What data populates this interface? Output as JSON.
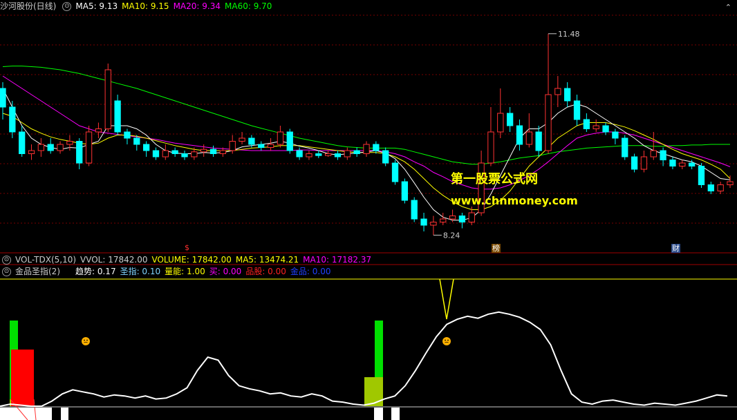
{
  "price_header": {
    "title": "沙河股份(日线)",
    "ma5": "MA5: 9.13",
    "ma10": "MA10: 9.15",
    "ma20": "MA20: 9.34",
    "ma60": "MA60: 9.70",
    "colors": {
      "ma5": "#ffffff",
      "ma10": "#ffff00",
      "ma20": "#ff00ff",
      "ma60": "#00ff00"
    }
  },
  "price_chart": {
    "high_label": "11.48",
    "low_label": "8.24",
    "markers": {
      "s": "$",
      "bang": "榜",
      "cai": "财"
    },
    "up_color": "#ff3232",
    "down_color": "#00ffff"
  },
  "volume_header": {
    "name": "VOL-TDX(5,10)",
    "vvol": "VVOL: 17842.00",
    "volume": "VOLUME: 17842.00",
    "ma5": "MA5: 13474.21",
    "ma10": "MA10: 17182.37"
  },
  "indicator_header": {
    "name": "金品圣指(2)",
    "trend": "趋势: 0.17",
    "sheng": "圣指: 0.10",
    "liang": "量能: 1.00",
    "buy": "买: 0.00",
    "pin": "品股: 0.00",
    "jinpin": "金品: 0.00"
  },
  "watermark": {
    "cn": "第一股票公式网",
    "url": "www.chnmoney.com"
  },
  "chart_data": {
    "type": "candlestick",
    "ylim": [
      8.0,
      11.8
    ],
    "high": 11.48,
    "low": 8.24,
    "candles": [
      [
        10.6,
        10.3,
        10.7,
        10.1
      ],
      [
        10.3,
        9.9,
        10.4,
        9.8
      ],
      [
        9.9,
        9.55,
        10.0,
        9.5
      ],
      [
        9.55,
        9.6,
        9.7,
        9.45
      ],
      [
        9.6,
        9.7,
        9.8,
        9.5
      ],
      [
        9.7,
        9.6,
        9.8,
        9.55
      ],
      [
        9.6,
        9.7,
        9.75,
        9.55
      ],
      [
        9.7,
        9.75,
        9.85,
        9.6
      ],
      [
        9.75,
        9.4,
        9.8,
        9.3
      ],
      [
        9.4,
        9.9,
        10.0,
        9.35
      ],
      [
        9.9,
        9.95,
        10.05,
        9.8
      ],
      [
        9.95,
        10.9,
        11.0,
        9.9
      ],
      [
        10.4,
        9.9,
        10.5,
        9.85
      ],
      [
        9.9,
        9.8,
        9.95,
        9.7
      ],
      [
        9.8,
        9.7,
        9.85,
        9.6
      ],
      [
        9.7,
        9.6,
        9.75,
        9.5
      ],
      [
        9.6,
        9.5,
        9.65,
        9.45
      ],
      [
        9.5,
        9.6,
        9.7,
        9.45
      ],
      [
        9.6,
        9.55,
        9.65,
        9.5
      ],
      [
        9.55,
        9.5,
        9.6,
        9.45
      ],
      [
        9.5,
        9.58,
        9.65,
        9.45
      ],
      [
        9.58,
        9.62,
        9.7,
        9.5
      ],
      [
        9.62,
        9.55,
        9.68,
        9.5
      ],
      [
        9.55,
        9.6,
        9.65,
        9.5
      ],
      [
        9.6,
        9.75,
        9.85,
        9.55
      ],
      [
        9.75,
        9.8,
        9.9,
        9.7
      ],
      [
        9.8,
        9.7,
        9.85,
        9.65
      ],
      [
        9.7,
        9.65,
        9.75,
        9.6
      ],
      [
        9.65,
        9.7,
        9.8,
        9.6
      ],
      [
        9.7,
        9.9,
        10.0,
        9.65
      ],
      [
        9.9,
        9.6,
        9.95,
        9.55
      ],
      [
        9.6,
        9.5,
        9.65,
        9.45
      ],
      [
        9.5,
        9.55,
        9.6,
        9.45
      ],
      [
        9.55,
        9.52,
        9.6,
        9.48
      ],
      [
        9.52,
        9.55,
        9.6,
        9.5
      ],
      [
        9.55,
        9.5,
        9.6,
        9.45
      ],
      [
        9.5,
        9.6,
        9.65,
        9.45
      ],
      [
        9.6,
        9.55,
        9.65,
        9.5
      ],
      [
        9.55,
        9.7,
        9.75,
        9.5
      ],
      [
        9.7,
        9.6,
        9.75,
        9.55
      ],
      [
        9.6,
        9.4,
        9.65,
        9.35
      ],
      [
        9.4,
        9.1,
        9.45,
        9.05
      ],
      [
        9.1,
        8.8,
        9.15,
        8.75
      ],
      [
        8.8,
        8.5,
        8.85,
        8.45
      ],
      [
        8.5,
        8.4,
        8.6,
        8.3
      ],
      [
        8.4,
        8.45,
        8.55,
        8.24
      ],
      [
        8.45,
        8.5,
        8.6,
        8.4
      ],
      [
        8.5,
        8.55,
        8.65,
        8.45
      ],
      [
        8.55,
        8.45,
        8.6,
        8.35
      ],
      [
        8.45,
        8.6,
        8.7,
        8.4
      ],
      [
        8.6,
        9.4,
        9.6,
        8.55
      ],
      [
        9.4,
        9.9,
        10.3,
        9.35
      ],
      [
        9.9,
        10.2,
        10.6,
        9.8
      ],
      [
        10.2,
        10.0,
        10.3,
        9.9
      ],
      [
        10.0,
        9.7,
        10.1,
        9.6
      ],
      [
        9.7,
        9.9,
        10.2,
        9.65
      ],
      [
        9.9,
        9.6,
        10.0,
        9.5
      ],
      [
        9.6,
        10.5,
        11.48,
        9.55
      ],
      [
        10.5,
        10.6,
        10.8,
        10.3
      ],
      [
        10.6,
        10.4,
        10.7,
        10.3
      ],
      [
        10.4,
        10.1,
        10.5,
        10.0
      ],
      [
        10.1,
        9.95,
        10.2,
        9.9
      ],
      [
        9.95,
        10.0,
        10.1,
        9.9
      ],
      [
        10.0,
        9.9,
        10.05,
        9.85
      ],
      [
        9.9,
        9.8,
        9.95,
        9.7
      ],
      [
        9.8,
        9.5,
        9.85,
        9.45
      ],
      [
        9.5,
        9.3,
        9.55,
        9.25
      ],
      [
        9.3,
        9.5,
        9.6,
        9.25
      ],
      [
        9.5,
        9.6,
        9.9,
        9.45
      ],
      [
        9.6,
        9.45,
        9.65,
        9.35
      ],
      [
        9.45,
        9.35,
        9.5,
        9.3
      ],
      [
        9.35,
        9.4,
        9.45,
        9.3
      ],
      [
        9.4,
        9.35,
        9.45,
        9.3
      ],
      [
        9.35,
        9.05,
        9.4,
        9.0
      ],
      [
        9.05,
        8.95,
        9.1,
        8.9
      ],
      [
        8.95,
        9.05,
        9.1,
        8.9
      ],
      [
        9.05,
        9.1,
        9.2,
        9.0
      ]
    ],
    "ma5": [
      10.6,
      10.3,
      10.0,
      9.8,
      9.7,
      9.65,
      9.62,
      9.65,
      9.64,
      9.7,
      9.75,
      10.0,
      10.0,
      10.0,
      9.95,
      9.85,
      9.7,
      9.6,
      9.56,
      9.55,
      9.55,
      9.57,
      9.56,
      9.57,
      9.6,
      9.66,
      9.68,
      9.7,
      9.72,
      9.75,
      9.72,
      9.67,
      9.64,
      9.6,
      9.55,
      9.53,
      9.55,
      9.56,
      9.58,
      9.6,
      9.56,
      9.47,
      9.3,
      9.08,
      8.85,
      8.65,
      8.53,
      8.48,
      8.48,
      8.52,
      8.65,
      8.9,
      9.2,
      9.5,
      9.8,
      9.95,
      9.95,
      10.05,
      10.2,
      10.3,
      10.35,
      10.3,
      10.2,
      10.1,
      10.0,
      9.9,
      9.8,
      9.68,
      9.6,
      9.55,
      9.5,
      9.45,
      9.42,
      9.35,
      9.25,
      9.15,
      9.13
    ],
    "ma10": [
      10.2,
      10.15,
      10.05,
      9.95,
      9.88,
      9.82,
      9.78,
      9.75,
      9.72,
      9.7,
      9.72,
      9.8,
      9.85,
      9.85,
      9.83,
      9.8,
      9.76,
      9.72,
      9.68,
      9.65,
      9.62,
      9.6,
      9.6,
      9.6,
      9.6,
      9.62,
      9.64,
      9.65,
      9.66,
      9.68,
      9.68,
      9.68,
      9.66,
      9.64,
      9.62,
      9.6,
      9.58,
      9.57,
      9.57,
      9.57,
      9.55,
      9.5,
      9.42,
      9.3,
      9.15,
      9.0,
      8.88,
      8.78,
      8.7,
      8.65,
      8.65,
      8.7,
      8.8,
      8.95,
      9.15,
      9.35,
      9.5,
      9.65,
      9.8,
      9.9,
      10.0,
      10.05,
      10.05,
      10.05,
      10.02,
      9.98,
      9.92,
      9.85,
      9.78,
      9.7,
      9.62,
      9.55,
      9.5,
      9.45,
      9.38,
      9.3,
      9.15
    ],
    "ma20": [
      10.8,
      10.7,
      10.6,
      10.5,
      10.4,
      10.3,
      10.2,
      10.1,
      10.0,
      9.95,
      9.9,
      9.88,
      9.86,
      9.84,
      9.82,
      9.8,
      9.78,
      9.75,
      9.72,
      9.7,
      9.68,
      9.66,
      9.64,
      9.63,
      9.62,
      9.61,
      9.6,
      9.6,
      9.6,
      9.6,
      9.6,
      9.61,
      9.61,
      9.6,
      9.6,
      9.6,
      9.6,
      9.6,
      9.6,
      9.6,
      9.58,
      9.55,
      9.5,
      9.42,
      9.35,
      9.25,
      9.18,
      9.1,
      9.05,
      9.0,
      8.98,
      8.98,
      9.0,
      9.05,
      9.12,
      9.2,
      9.3,
      9.42,
      9.55,
      9.68,
      9.8,
      9.85,
      9.88,
      9.9,
      9.9,
      9.88,
      9.85,
      9.8,
      9.75,
      9.7,
      9.65,
      9.6,
      9.55,
      9.5,
      9.45,
      9.4,
      9.34
    ],
    "ma60": [
      10.95,
      10.96,
      10.96,
      10.95,
      10.94,
      10.92,
      10.9,
      10.87,
      10.84,
      10.8,
      10.76,
      10.72,
      10.68,
      10.64,
      10.6,
      10.55,
      10.5,
      10.45,
      10.4,
      10.35,
      10.3,
      10.25,
      10.2,
      10.15,
      10.1,
      10.05,
      10.0,
      9.96,
      9.92,
      9.88,
      9.84,
      9.8,
      9.77,
      9.74,
      9.71,
      9.68,
      9.66,
      9.65,
      9.64,
      9.64,
      9.64,
      9.64,
      9.62,
      9.58,
      9.54,
      9.5,
      9.46,
      9.42,
      9.4,
      9.38,
      9.38,
      9.4,
      9.42,
      9.45,
      9.48,
      9.5,
      9.52,
      9.55,
      9.58,
      9.6,
      9.62,
      9.64,
      9.65,
      9.66,
      9.67,
      9.68,
      9.68,
      9.68,
      9.67,
      9.67,
      9.68,
      9.68,
      9.69,
      9.69,
      9.7,
      9.7,
      9.7
    ],
    "indicator": {
      "white_line": [
        0.0,
        0.02,
        0.01,
        0.0,
        0.0,
        0.05,
        0.12,
        0.16,
        0.14,
        0.12,
        0.09,
        0.11,
        0.1,
        0.08,
        0.1,
        0.07,
        0.08,
        0.12,
        0.18,
        0.35,
        0.48,
        0.45,
        0.3,
        0.2,
        0.17,
        0.15,
        0.12,
        0.13,
        0.1,
        0.09,
        0.12,
        0.1,
        0.05,
        0.04,
        0.02,
        0.01,
        0.03,
        0.07,
        0.1,
        0.2,
        0.35,
        0.52,
        0.68,
        0.8,
        0.85,
        0.88,
        0.86,
        0.9,
        0.92,
        0.9,
        0.87,
        0.82,
        0.75,
        0.6,
        0.35,
        0.12,
        0.04,
        0.02,
        0.05,
        0.06,
        0.04,
        0.02,
        0.01,
        0.03,
        0.02,
        0.01,
        0.03,
        0.05,
        0.08,
        0.11,
        0.1
      ],
      "yellow_line": [
        1,
        1,
        1,
        1,
        1,
        1,
        1,
        1,
        1,
        1,
        1,
        1,
        1,
        1,
        1,
        1,
        1,
        1,
        1,
        1,
        1,
        1,
        1,
        1,
        1,
        1,
        1,
        1,
        1,
        1,
        1,
        1,
        1,
        1,
        1,
        1,
        1,
        1,
        1,
        1,
        1,
        1,
        1,
        1,
        1,
        1,
        1,
        1,
        1,
        1,
        1,
        1,
        1,
        1,
        1,
        1,
        1,
        1,
        1,
        1,
        1,
        1,
        1,
        1,
        1,
        1,
        1,
        1,
        1,
        1,
        1
      ]
    }
  }
}
